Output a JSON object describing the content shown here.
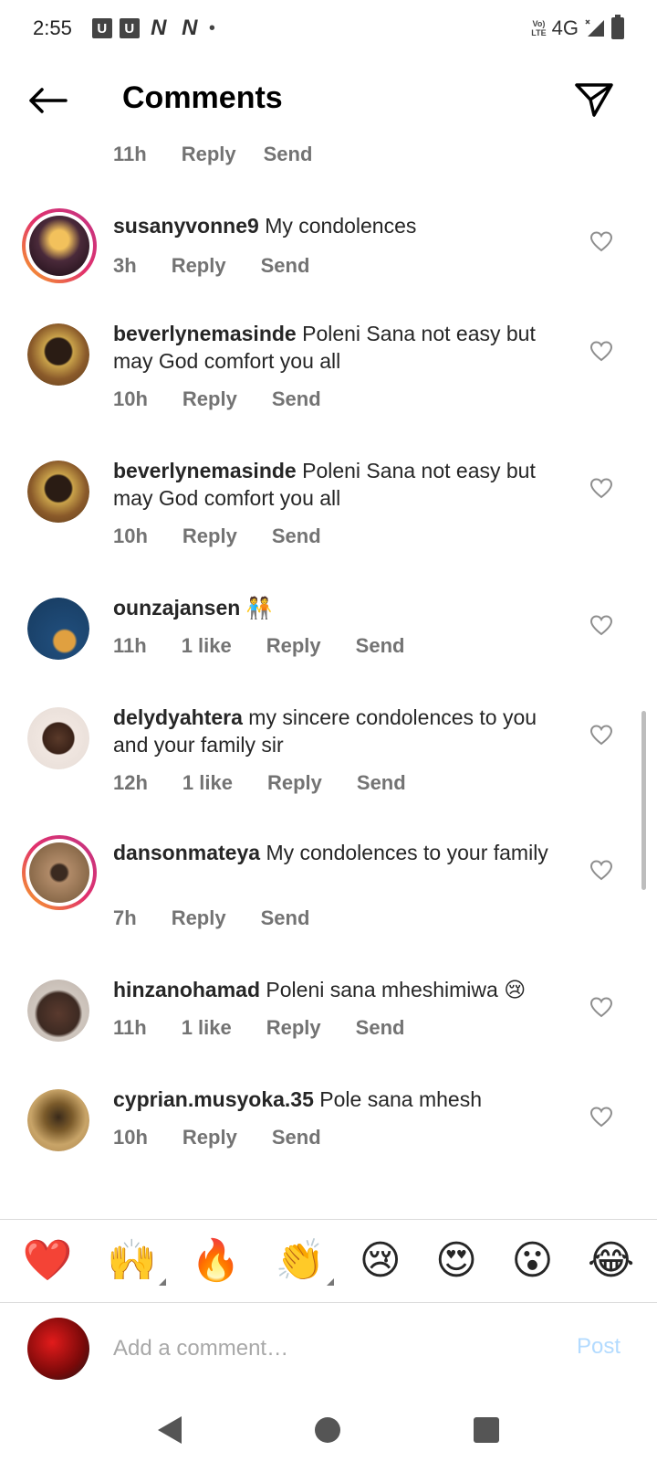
{
  "status_bar": {
    "time": "2:55",
    "notif_icons": [
      "U",
      "U",
      "N",
      "N"
    ],
    "network": "4G",
    "volte": "Vo) LTE"
  },
  "header": {
    "title": "Comments"
  },
  "partial_comment": {
    "time": "11h",
    "reply": "Reply",
    "send": "Send"
  },
  "comments": [
    {
      "username": "susanyvonne9",
      "text": "My condolences",
      "time": "3h",
      "likes": "",
      "reply": "Reply",
      "send": "Send",
      "story": true,
      "avatar_color": "#4a2a3a"
    },
    {
      "username": "beverlynemasinde",
      "text": "Poleni Sana not easy but may God comfort you all",
      "time": "10h",
      "likes": "",
      "reply": "Reply",
      "send": "Send",
      "story": false,
      "avatar_color": "#6b4a2a"
    },
    {
      "username": "beverlynemasinde",
      "text": "Poleni Sana not easy but may God comfort you all",
      "time": "10h",
      "likes": "",
      "reply": "Reply",
      "send": "Send",
      "story": false,
      "avatar_color": "#6b4a2a"
    },
    {
      "username": "ounzajansen",
      "text": "🧑‍🤝‍🧑",
      "time": "11h",
      "likes": "1 like",
      "reply": "Reply",
      "send": "Send",
      "story": false,
      "avatar_color": "#1f4b78"
    },
    {
      "username": "delydyahtera",
      "text": "my sincere condolences to you and your family sir",
      "time": "12h",
      "likes": "1 like",
      "reply": "Reply",
      "send": "Send",
      "story": false,
      "avatar_color": "#3a2a22"
    },
    {
      "username": "dansonmateya",
      "text": "My condolences to your family",
      "time": "7h",
      "likes": "",
      "reply": "Reply",
      "send": "Send",
      "story": true,
      "avatar_color": "#8a6a4a"
    },
    {
      "username": "hinzanohamad",
      "text": "Poleni sana mheshimiwa 😢",
      "time": "11h",
      "likes": "1 like",
      "reply": "Reply",
      "send": "Send",
      "story": false,
      "avatar_color": "#3d2a22"
    },
    {
      "username": "cyprian.musyoka.35",
      "text": "Pole sana mhesh",
      "time": "10h",
      "likes": "",
      "reply": "Reply",
      "send": "Send",
      "story": false,
      "avatar_color": "#b08850"
    }
  ],
  "emoji_bar": [
    "❤️",
    "🙌",
    "🔥",
    "👏",
    "😢",
    "😍",
    "😮",
    "😂"
  ],
  "add_comment": {
    "placeholder": "Add a comment…",
    "post_label": "Post"
  },
  "colors": {
    "accent_disabled": "#b3dbff",
    "meta_gray": "#737373"
  }
}
